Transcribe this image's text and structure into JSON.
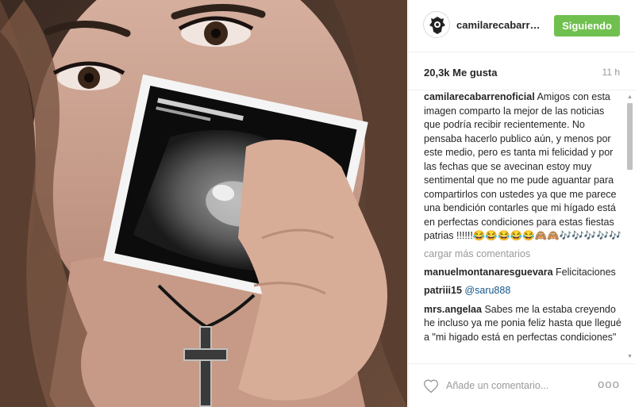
{
  "post": {
    "image_alt": "Woman holding an ultrasound photo in front of her face"
  },
  "header": {
    "username": "camilarecabarre...",
    "follow_label": "Siguiendo",
    "avatar_icon": "crest-logo-icon"
  },
  "meta": {
    "likes": "20,3k Me gusta",
    "timestamp": "11 h"
  },
  "caption": {
    "username": "camilarecabarrenoficial",
    "text": "Amigos con esta imagen comparto la mejor de las noticias que podría recibir recientemente. No pensaba hacerlo publico aún, y menos por este medio, pero es tanta mi felicidad y por las fechas que se avecinan estoy muy sentimental que no me pude aguantar para compartirlos con ustedes ya que me parece una bendición contarles que mi hígado está en perfectas condiciones para estas fiestas patrias !!!!!!",
    "emojis": "😂😂😂😂😂🙈🙈🎶🎶🎶🎶🎶"
  },
  "load_more": "cargar más comentarios",
  "comments": [
    {
      "username": "manuelmontanaresguevara",
      "text": "Felicitaciones",
      "mention": ""
    },
    {
      "username": "patriii15",
      "text": "",
      "mention": "@saru888"
    },
    {
      "username": "mrs.angelaa",
      "text": "Sabes me la estaba creyendo he incluso ya me ponia feliz hasta que llegué a \"mi higado está en perfectas condiciones\"",
      "mention": ""
    }
  ],
  "footer": {
    "comment_placeholder": "Añade un comentario...",
    "heart_icon": "heart-outline-icon",
    "more_icon": "more-options-icon",
    "more_label": "ooo"
  },
  "colors": {
    "follow_button": "#70c050",
    "mention": "#125688",
    "secondary_text": "#999999"
  }
}
